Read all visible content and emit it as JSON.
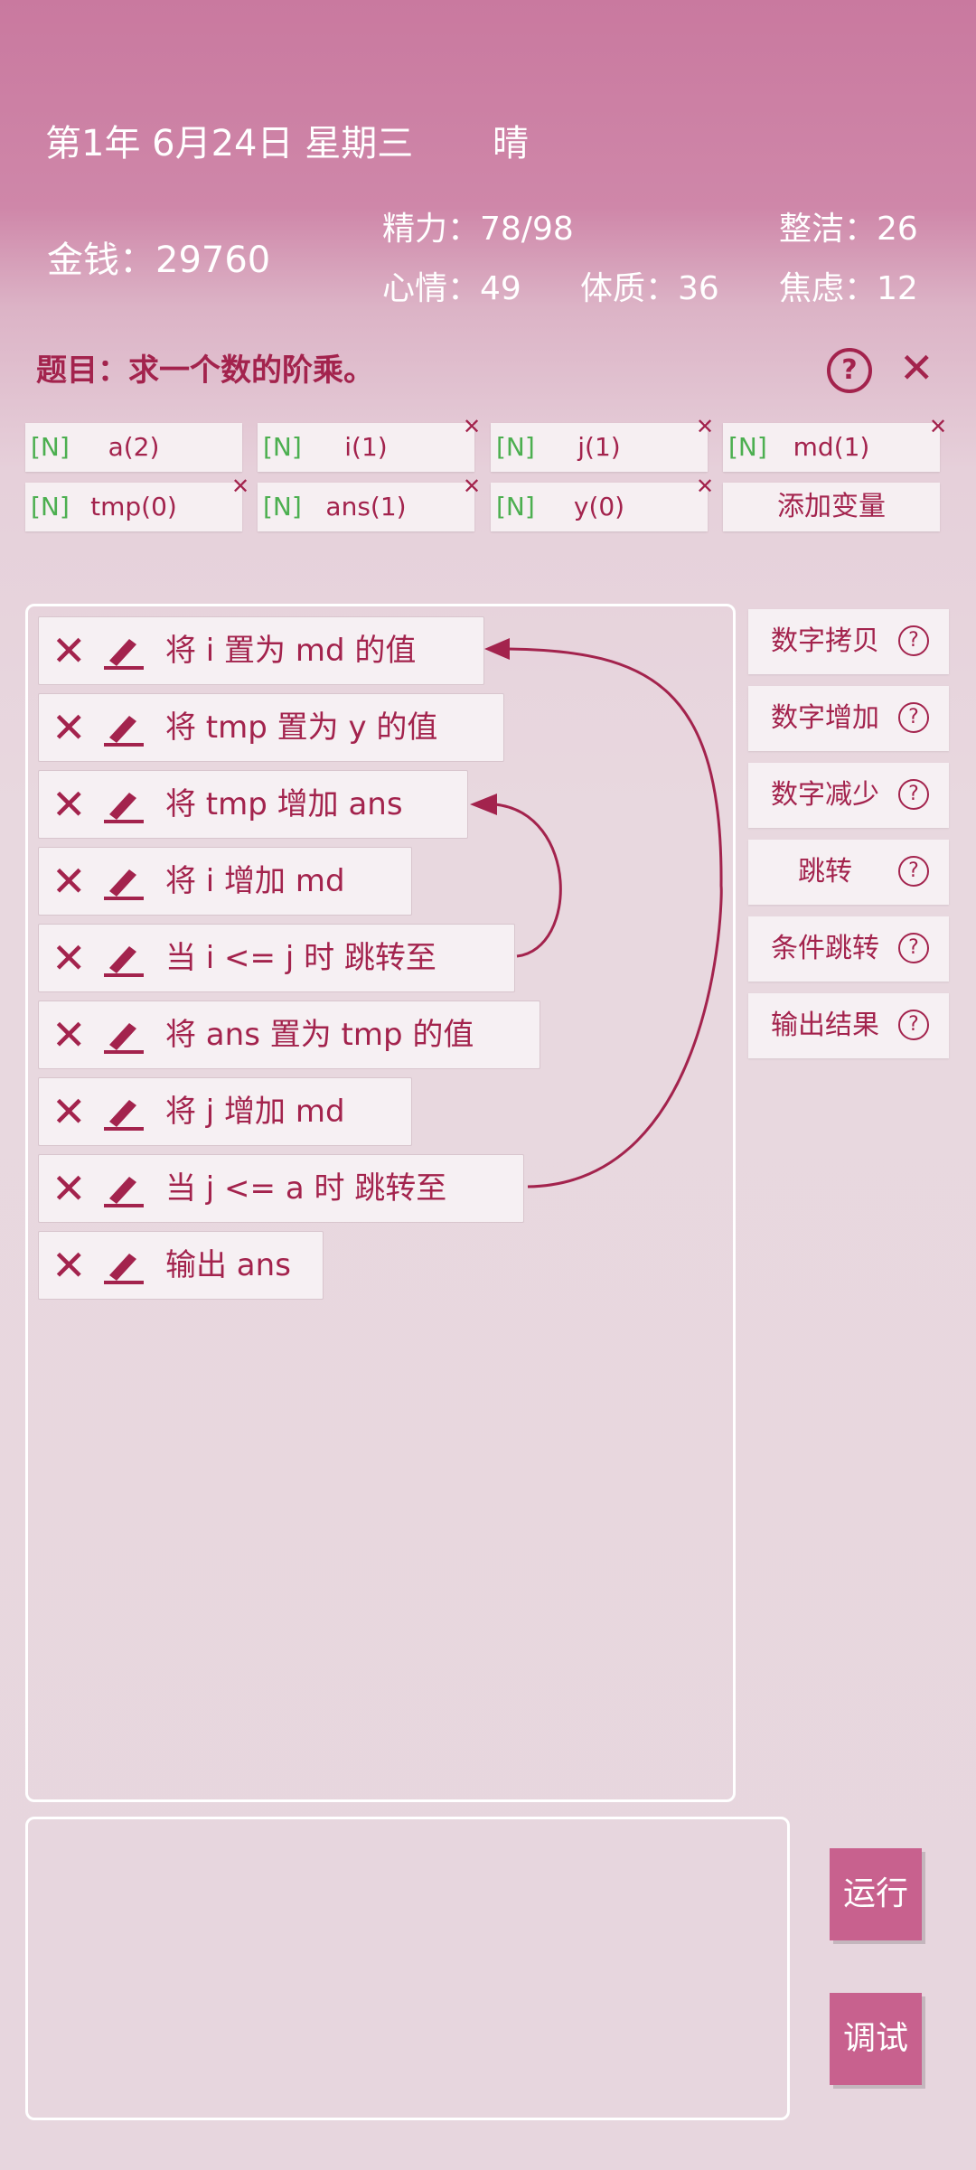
{
  "header": {
    "date": "第1年 6月24日 星期三",
    "weather": "晴",
    "money": "金钱：29760",
    "energy": "精力：78/98",
    "cleanliness": "整洁：26",
    "mood": "心情：49",
    "physique": "体质：36",
    "anxiety": "焦虑：12"
  },
  "problem": {
    "title": "题目：求一个数的阶乘。"
  },
  "variables": [
    {
      "type": "[N]",
      "label": "a(2)"
    },
    {
      "type": "[N]",
      "label": "i(1)"
    },
    {
      "type": "[N]",
      "label": "j(1)"
    },
    {
      "type": "[N]",
      "label": "md(1)"
    },
    {
      "type": "[N]",
      "label": "tmp(0)"
    },
    {
      "type": "[N]",
      "label": "ans(1)"
    },
    {
      "type": "[N]",
      "label": "y(0)"
    }
  ],
  "add_variable_label": "添加变量",
  "statements": [
    "将 i 置为 md 的值",
    "将 tmp 置为 y 的值",
    "将 tmp 增加 ans",
    "将 i 增加 md",
    "当 i <= j 时 跳转至",
    "将 ans 置为 tmp 的值",
    "将 j 增加 md",
    "当 j <= a 时 跳转至",
    "输出 ans"
  ],
  "commands": [
    "数字拷贝",
    "数字增加",
    "数字减少",
    "跳转",
    "条件跳转",
    "输出结果"
  ],
  "buttons": {
    "run": "运行",
    "debug": "调试"
  },
  "colors": {
    "accent": "#a3234d",
    "var_type": "#4caf50",
    "button": "#c8618e"
  },
  "icons": {
    "delete": "close-icon",
    "edit": "pencil-icon",
    "help": "help-icon"
  }
}
